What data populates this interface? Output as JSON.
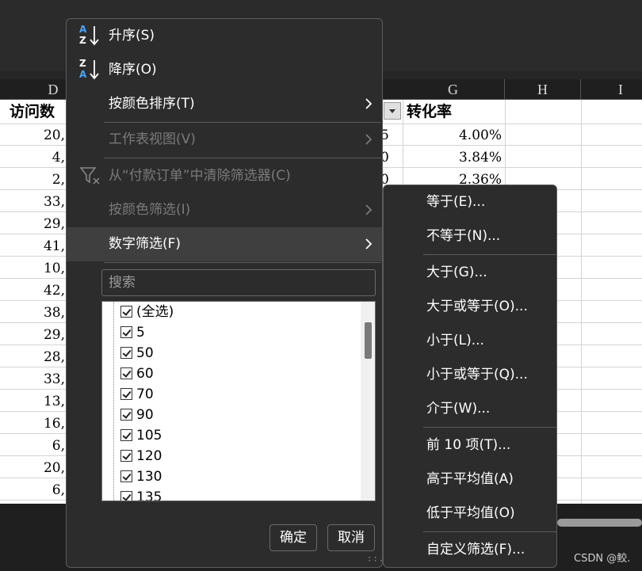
{
  "sheet": {
    "columns": [
      "D",
      "G",
      "H",
      "I"
    ],
    "header_d": "访问数",
    "header_g": "转化率",
    "col_d_values": [
      "20,",
      "4,",
      "2,",
      "33,",
      "29,",
      "41,",
      "10,",
      "42,",
      "38,",
      "29,",
      "28,",
      "33,",
      "13,",
      "16,",
      "6,",
      "20,",
      "6,"
    ],
    "col_f_values": [
      "5",
      "0",
      "0"
    ],
    "col_g_values": [
      "4.00%",
      "3.84%",
      "2.36%"
    ]
  },
  "menu": {
    "sort_asc": "升序(S)",
    "sort_desc": "降序(O)",
    "sort_by_color": "按颜色排序(T)",
    "sheet_view": "工作表视图(V)",
    "clear_filter": "从“付款订单”中清除筛选器(C)",
    "filter_by_color": "按颜色筛选(I)",
    "number_filter": "数字筛选(F)",
    "search_placeholder": "搜索",
    "list_items": [
      "(全选)",
      "5",
      "50",
      "60",
      "70",
      "90",
      "105",
      "120",
      "130",
      "135"
    ],
    "ok_button": "确定",
    "cancel_button": "取消"
  },
  "submenu": {
    "items": [
      "等于(E)...",
      "不等于(N)...",
      "大于(G)...",
      "大于或等于(O)...",
      "小于(L)...",
      "小于或等于(Q)...",
      "介于(W)...",
      "前 10 项(T)...",
      "高于平均值(A)",
      "低于平均值(O)",
      "自定义筛选(F)..."
    ]
  },
  "watermark": "CSDN @鲛.",
  "colors": {
    "menu_bg": "#2c2c2c",
    "hover_bg": "#3f3f3f",
    "accent_blue": "#4aa3ff"
  },
  "icons": [
    "sort-ascending-icon",
    "sort-descending-icon",
    "clear-filter-icon",
    "submenu-arrow-icon",
    "checkbox-icon",
    "dropdown-arrow-icon"
  ]
}
